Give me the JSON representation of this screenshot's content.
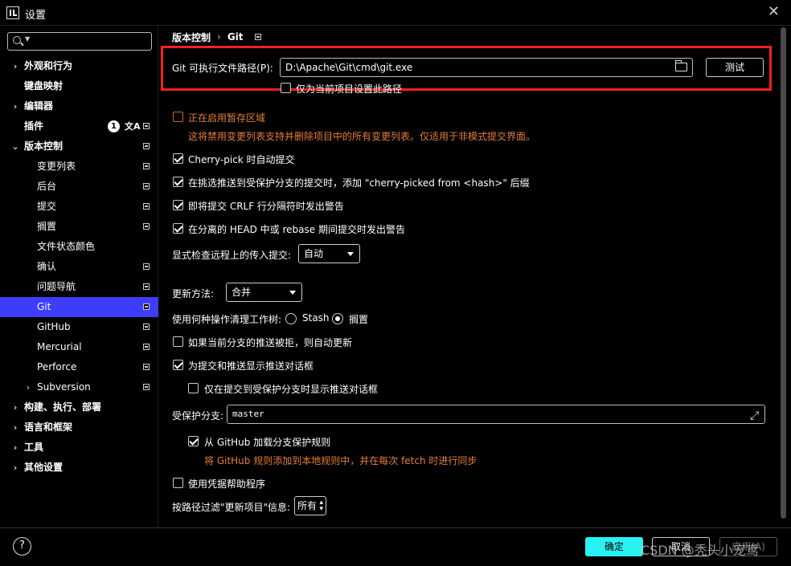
{
  "window": {
    "title": "设置",
    "close": "✕"
  },
  "sidebar": {
    "search_placeholder": "",
    "items": [
      {
        "label": "外观和行为",
        "chevron": "›"
      },
      {
        "label": "键盘映射"
      },
      {
        "label": "编辑器",
        "chevron": "›"
      },
      {
        "label": "插件",
        "badge": "1",
        "translate": "文A"
      },
      {
        "label": "版本控制",
        "chevron": "⌄"
      },
      {
        "label": "变更列表"
      },
      {
        "label": "后台"
      },
      {
        "label": "提交"
      },
      {
        "label": "搁置"
      },
      {
        "label": "文件状态颜色"
      },
      {
        "label": "确认"
      },
      {
        "label": "问题导航"
      },
      {
        "label": "Git"
      },
      {
        "label": "GitHub"
      },
      {
        "label": "Mercurial"
      },
      {
        "label": "Perforce"
      },
      {
        "label": "Subversion",
        "chevron": "›"
      },
      {
        "label": "构建、执行、部署",
        "chevron": "›"
      },
      {
        "label": "语言和框架",
        "chevron": "›"
      },
      {
        "label": "工具",
        "chevron": "›"
      },
      {
        "label": "其他设置",
        "chevron": "›"
      }
    ]
  },
  "breadcrumb": {
    "parent": "版本控制",
    "sep": "›",
    "current": "Git"
  },
  "git": {
    "exe_label": "Git 可执行文件路径(P):",
    "exe_value": "D:\\Apache\\Git\\cmd\\git.exe",
    "test_button": "测试",
    "project_only": "仅为当前项目设置此路径",
    "staging_area": "正在启用暂存区域",
    "staging_note": "这将禁用变更列表支持并删除项目中的所有变更列表。仅适用于非模式提交界面。",
    "cherry_pick_auto": "Cherry-pick 时自动提交",
    "cherry_pick_suffix": "在挑选推送到受保护分支的提交时，添加 \"cherry-picked from <hash>\" 后缀",
    "crlf_warn": "即将提交 CRLF 行分隔符时发出警告",
    "detached_warn": "在分离的 HEAD 中或 rebase 期间提交时发出警告",
    "incoming_label": "显式检查远程上的传入提交:",
    "incoming_value": "自动",
    "update_label": "更新方法:",
    "update_value": "合并",
    "clean_label": "使用何种操作清理工作树:",
    "clean_stash": "Stash",
    "clean_shelve": "搁置",
    "auto_update_rejected": "如果当前分支的推送被拒，则自动更新",
    "show_push_dialog": "为提交和推送显示推送对话框",
    "push_dialog_protected": "仅在提交到受保护分支时显示推送对话框",
    "protected_label": "受保护分支:",
    "protected_value": "master",
    "load_github_rules": "从 GitHub 加载分支保护规则",
    "github_rules_note": "将 GitHub 规则添加到本地规则中，并在每次 fetch 时进行同步",
    "credential_helper": "使用凭据帮助程序",
    "filter_label": "按路径过滤\"更新项目\"信息:",
    "filter_value": "所有"
  },
  "footer": {
    "help": "?",
    "ok": "确定",
    "cancel": "取消",
    "apply": "应用(A)",
    "watermark": "CSDN @秃头小宠鸢"
  },
  "colors": {
    "selected": "#3d3dff",
    "primary_button": "#2af2f2",
    "highlight_border": "#ff1f1f",
    "warning_text": "#e67e35"
  }
}
